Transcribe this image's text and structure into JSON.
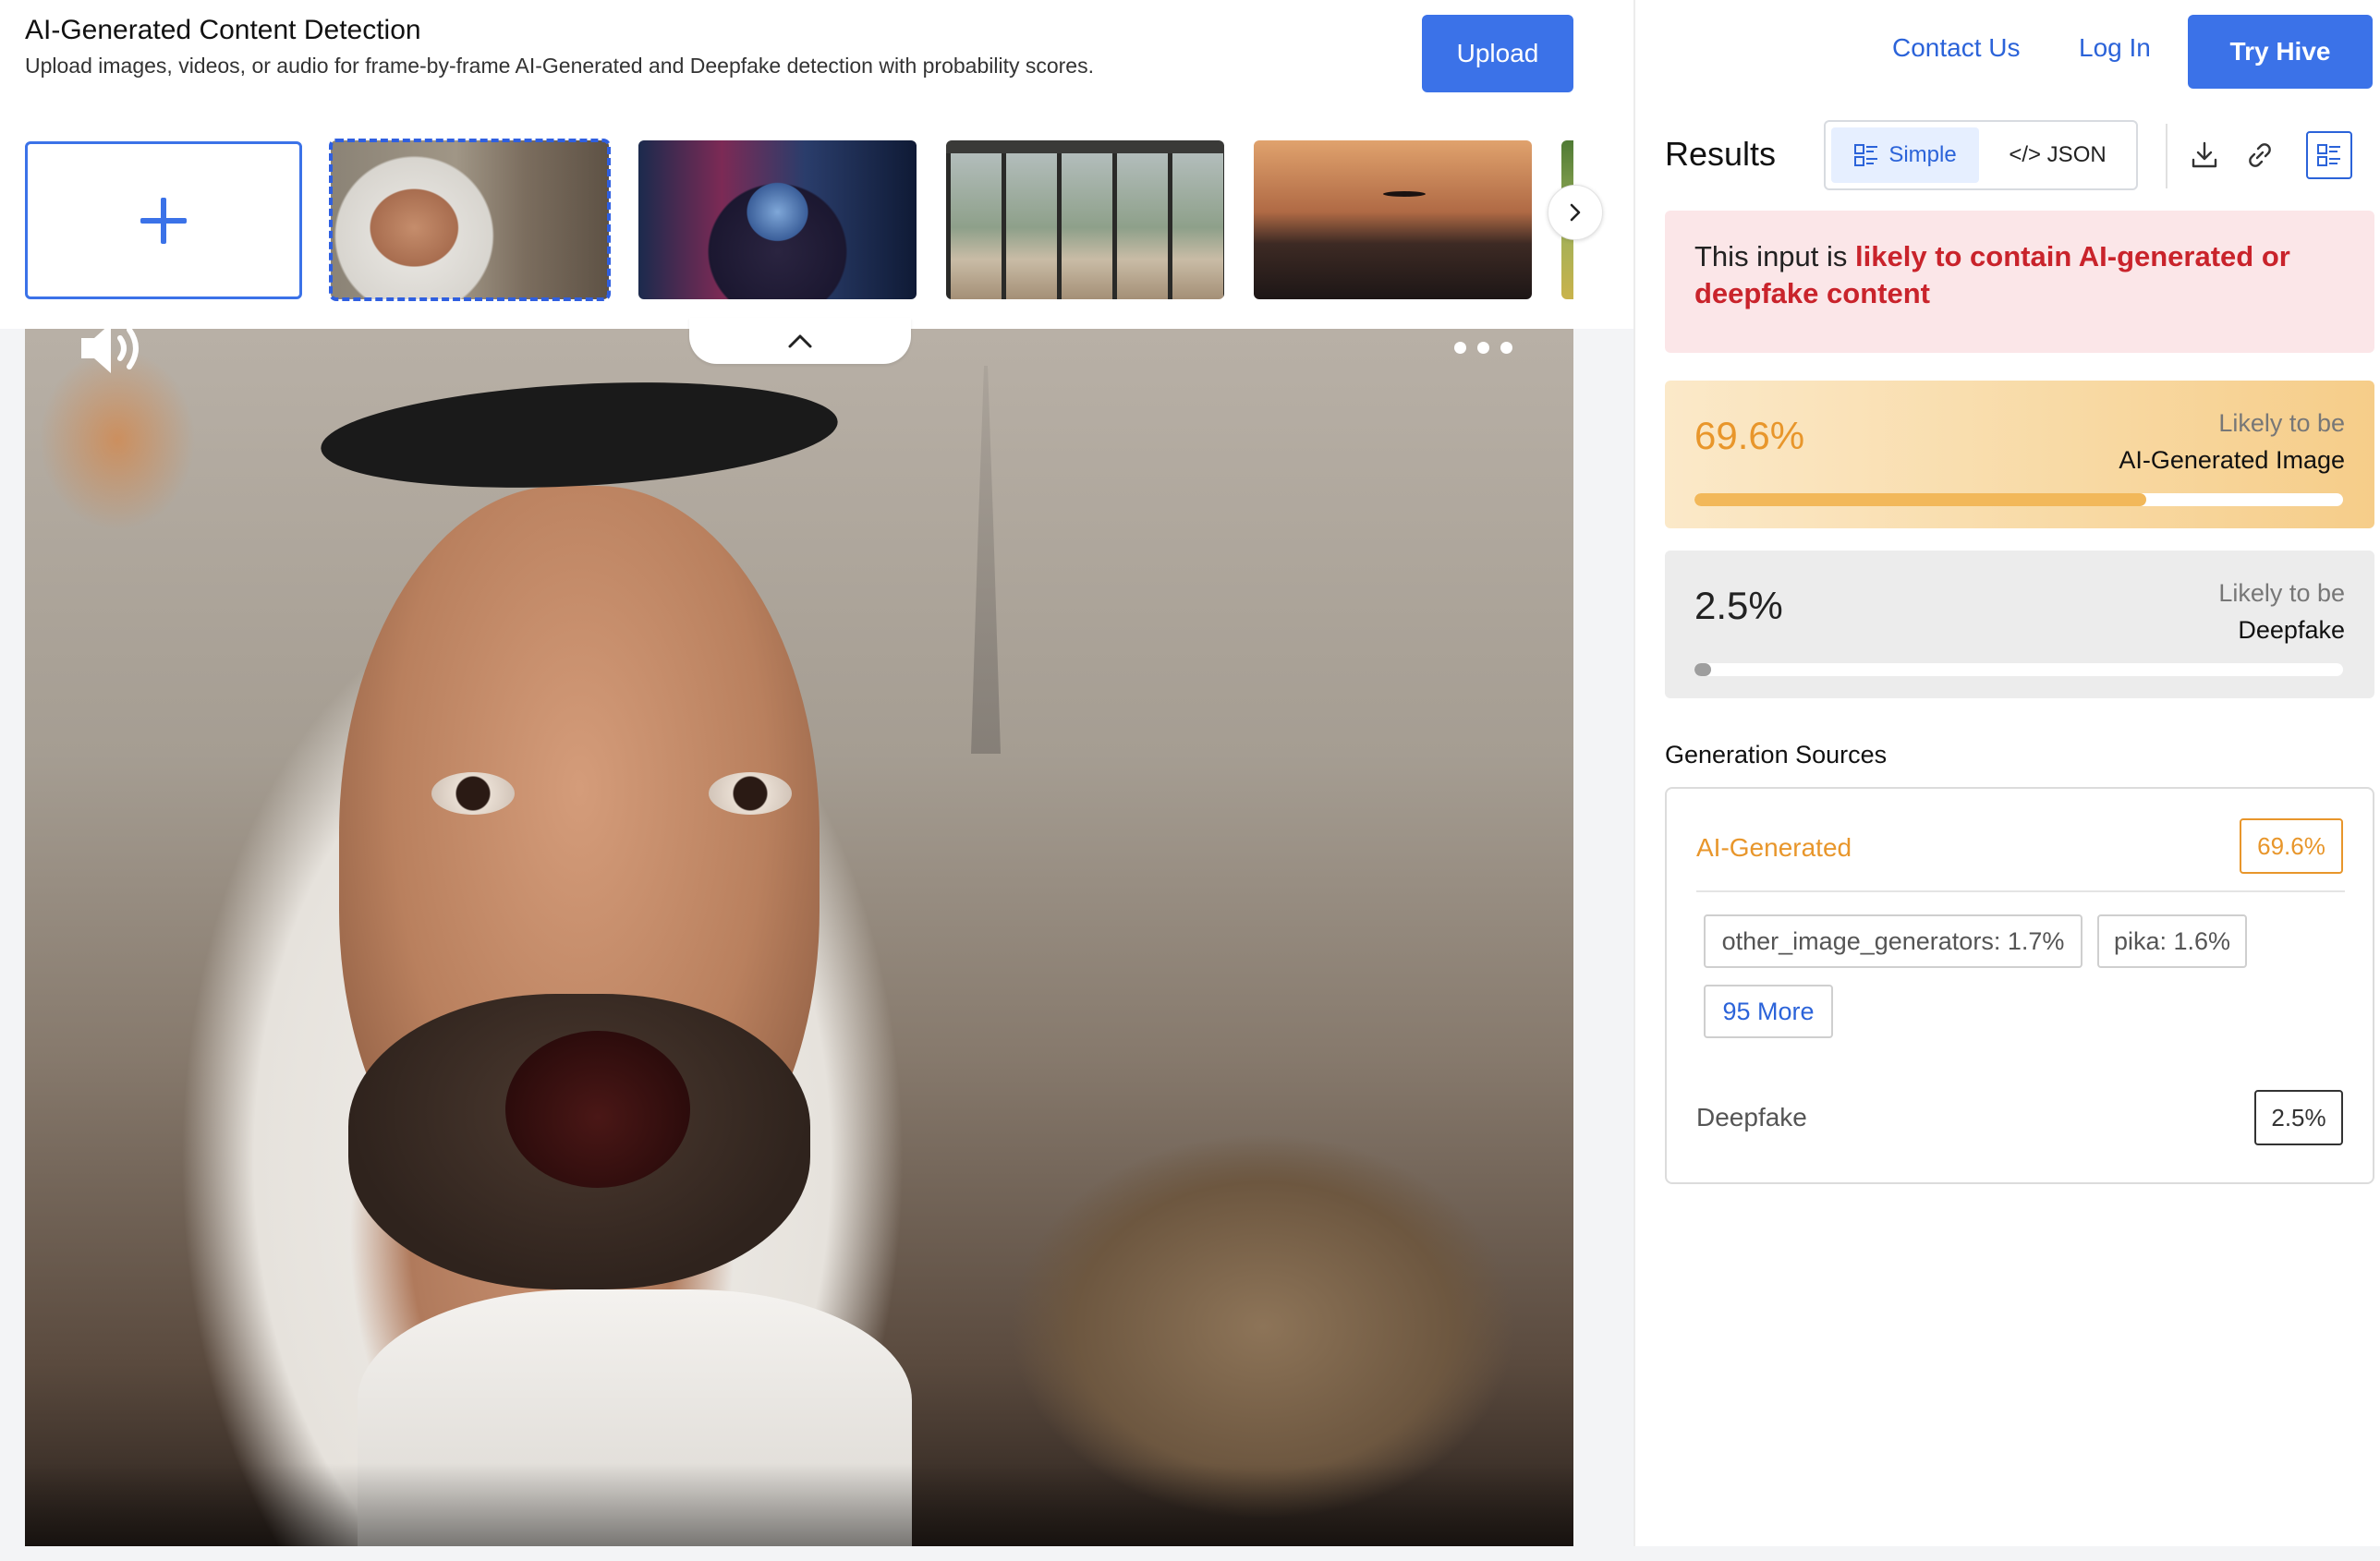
{
  "header": {
    "title": "AI-Generated Content Detection",
    "subtitle": "Upload images, videos, or audio for frame-by-frame AI-Generated and Deepfake detection with probability scores.",
    "upload_label": "Upload"
  },
  "thumbnails": {
    "add_icon": "plus-icon",
    "selected_index": 1,
    "next_icon": "chevron-right-icon"
  },
  "viewer": {
    "audio_icon": "speaker-icon",
    "collapse_icon": "chevron-up-icon",
    "more_icon": "more-dots-icon"
  },
  "nav": {
    "contact": "Contact Us",
    "login": "Log In",
    "try": "Try Hive"
  },
  "results": {
    "title": "Results",
    "view_simple": "Simple",
    "view_json": "</> JSON",
    "active_view": "Simple",
    "icons": [
      "download-icon",
      "link-icon",
      "list-view-icon"
    ],
    "verdict_prefix": "This input is ",
    "verdict_highlight": "likely to contain AI-generated or deepfake content"
  },
  "scores": {
    "ai": {
      "value_text": "69.6%",
      "value": 0.696,
      "caption_top": "Likely to be",
      "caption_strong": "AI-Generated Image"
    },
    "deepfake": {
      "value_text": "2.5%",
      "value": 0.025,
      "caption_top": "Likely to be",
      "caption_strong": "Deepfake"
    }
  },
  "generation_sources": {
    "title": "Generation Sources",
    "ai_label": "AI-Generated",
    "ai_value": "69.6%",
    "chips": [
      "other_image_generators: 1.7%",
      "pika: 1.6%"
    ],
    "more": "95 More",
    "deepfake_label": "Deepfake",
    "deepfake_value": "2.5%"
  },
  "colors": {
    "accent": "#3b72e8",
    "ai_orange": "#e8962b",
    "verdict_red": "#c9232b"
  }
}
